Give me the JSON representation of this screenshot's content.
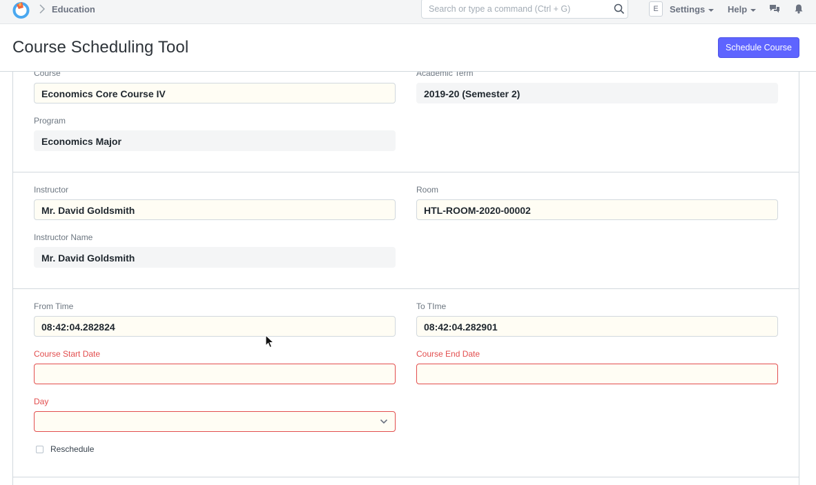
{
  "navbar": {
    "breadcrumb": "Education",
    "search_placeholder": "Search or type a command (Ctrl + G)",
    "avatar_initial": "E",
    "settings_label": "Settings",
    "help_label": "Help",
    "icons": [
      "app-logo",
      "chevron-right-icon",
      "search-icon",
      "chat-icon",
      "bell-icon"
    ]
  },
  "page": {
    "title": "Course Scheduling Tool",
    "primary_action": "Schedule Course",
    "accent_color": "#5e64ff",
    "error_color": "#e24c4c"
  },
  "form": {
    "course": {
      "label": "Course",
      "value": "Economics Core Course IV"
    },
    "academic_term": {
      "label": "Academic Term",
      "value": "2019-20 (Semester 2)"
    },
    "program": {
      "label": "Program",
      "value": "Economics Major"
    },
    "instructor": {
      "label": "Instructor",
      "value": "Mr. David Goldsmith"
    },
    "room": {
      "label": "Room",
      "value": "HTL-ROOM-2020-00002"
    },
    "instructor_name": {
      "label": "Instructor Name",
      "value": "Mr. David Goldsmith"
    },
    "from_time": {
      "label": "From Time",
      "value": "08:42:04.282824"
    },
    "to_time": {
      "label": "To TIme",
      "value": "08:42:04.282901"
    },
    "course_start_date": {
      "label": "Course Start Date",
      "value": ""
    },
    "course_end_date": {
      "label": "Course End Date",
      "value": ""
    },
    "day": {
      "label": "Day",
      "value": ""
    },
    "reschedule": {
      "label": "Reschedule",
      "checked": false
    }
  }
}
